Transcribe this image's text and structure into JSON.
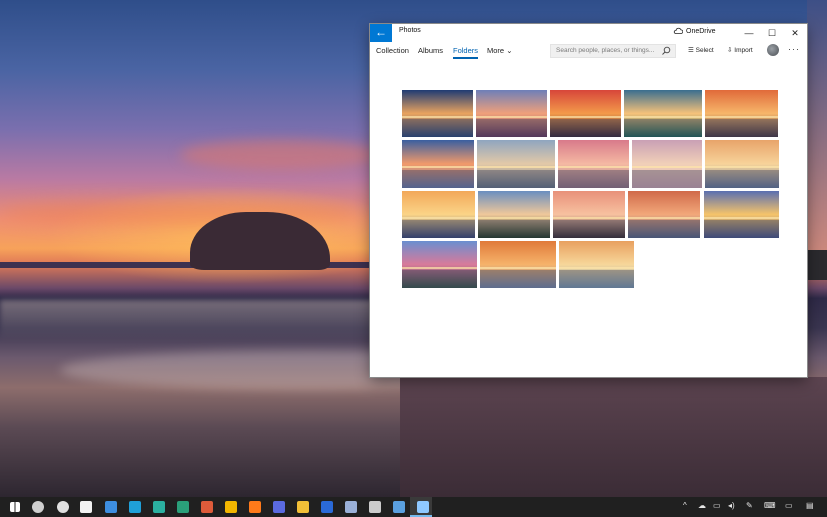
{
  "window": {
    "app_title": "Photos",
    "back_glyph": "←",
    "onedrive_label": "OneDrive",
    "minimize_glyph": "—",
    "maximize_glyph": "☐",
    "close_glyph": "✕"
  },
  "nav": {
    "tabs": [
      "Collection",
      "Albums",
      "Folders",
      "More"
    ],
    "active_tab": "Folders",
    "more_chevron": "⌄"
  },
  "search": {
    "placeholder": "Search people, places, or things..."
  },
  "toolbar": {
    "select_label": "Select",
    "import_label": "Import",
    "more_options_glyph": "···"
  },
  "colors": {
    "accent": "#0078d4",
    "active_tab": "#0063b1",
    "taskbar": "#202020"
  },
  "photos": [
    {
      "theme": "beach-sunset-blue",
      "c1": "#1f3b73",
      "c2": "#e9a35f",
      "c3": "#2b4c7f"
    },
    {
      "theme": "pink-shoreline",
      "c1": "#6e7fb8",
      "c2": "#f0a07a",
      "c3": "#6b3f63"
    },
    {
      "theme": "island-sunset-red",
      "c1": "#d7463a",
      "c2": "#f39a4a",
      "c3": "#3a2a38"
    },
    {
      "theme": "palm-lagoon-green",
      "c1": "#3a6e8f",
      "c2": "#f6c27a",
      "c3": "#1f6a5a"
    },
    {
      "theme": "pier-sunset-orange",
      "c1": "#e06a3a",
      "c2": "#f7b66a",
      "c3": "#4a3b45"
    },
    {
      "theme": "mountain-lake-blue",
      "c1": "#3a5fa0",
      "c2": "#f29a6a",
      "c3": "#6a7fb0"
    },
    {
      "theme": "pastel-horizon",
      "c1": "#8fa5c0",
      "c2": "#e3c9a8",
      "c3": "#6b7a8a"
    },
    {
      "theme": "pink-palm-beach",
      "c1": "#d87a8a",
      "c2": "#f5b9a3",
      "c3": "#9a7a8a"
    },
    {
      "theme": "soft-pink-shore",
      "c1": "#c9a0b5",
      "c2": "#f1d0b8",
      "c3": "#d8b0b8"
    },
    {
      "theme": "golden-sea",
      "c1": "#e8a46a",
      "c2": "#f7d39a",
      "c3": "#6a7fa0"
    },
    {
      "theme": "orange-sand-bar",
      "c1": "#f2a85a",
      "c2": "#fbd487",
      "c3": "#3a4a7a"
    },
    {
      "theme": "palms-blue-sky",
      "c1": "#6a8fc0",
      "c2": "#f0c89a",
      "c3": "#223a22"
    },
    {
      "theme": "pink-palm-sunset",
      "c1": "#e8917a",
      "c2": "#f7c1a0",
      "c3": "#3a2f30"
    },
    {
      "theme": "dusk-rocks",
      "c1": "#d06a4a",
      "c2": "#f2a87a",
      "c3": "#5a6a8a"
    },
    {
      "theme": "sunburst-bay",
      "c1": "#5a6fb0",
      "c2": "#f6c46a",
      "c3": "#4a5a8f"
    },
    {
      "theme": "coastal-lagoon",
      "c1": "#6a8fd0",
      "c2": "#d87a9a",
      "c3": "#3a5a4a"
    },
    {
      "theme": "driftwood-sunset",
      "c1": "#e07a3a",
      "c2": "#f6b36a",
      "c3": "#7a8fb0"
    },
    {
      "theme": "lone-tree-beach",
      "c1": "#e8a060",
      "c2": "#f7d79a",
      "c3": "#7fa0b8"
    }
  ],
  "taskbar": {
    "icons": [
      "windows-start-icon",
      "task-view-icon",
      "settings-icon",
      "store-icon",
      "phone-icon",
      "edge-icon",
      "edge-beta-icon",
      "edge-dev-icon",
      "chrome-icon",
      "chrome-canary-icon",
      "firefox-icon",
      "firefox-nightly-icon",
      "file-explorer-icon",
      "powershell-icon",
      "notepad-icon",
      "terminal-icon",
      "photos-icon",
      "onedrive-taskbar-icon"
    ]
  }
}
